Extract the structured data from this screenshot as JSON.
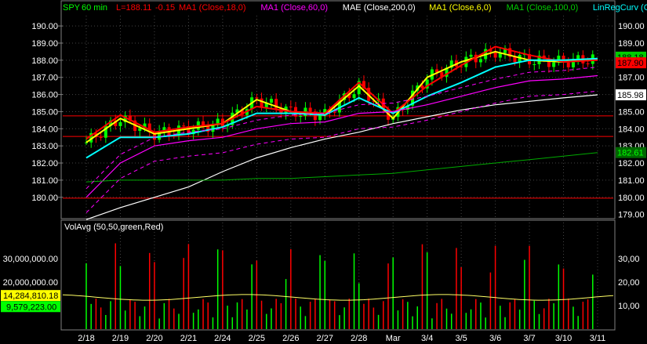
{
  "header": {
    "symbol": "SPY",
    "interval": "60 min",
    "last_label": "L=188.11",
    "change_label": "-0.15",
    "studies": [
      {
        "text": "MA1 (Close,18,0)",
        "color": "#ff0000"
      },
      {
        "text": "MA1 (Close,60,0)",
        "color": "#ff00ff"
      },
      {
        "text": "MAE (Close,200,0)",
        "color": "#ffffff"
      },
      {
        "text": "MA1 (Close,6,0)",
        "color": "#ffff00"
      },
      {
        "text": "MA1 (Close,100,0)",
        "color": "#00cc00"
      },
      {
        "text": "LinRegCurv (C…",
        "color": "#00ffff"
      }
    ]
  },
  "price_axis": {
    "ticks": [
      "190.00",
      "189.00",
      "188.00",
      "187.00",
      "186.00",
      "185.00",
      "184.00",
      "183.00",
      "182.00",
      "181.00",
      "180.00"
    ],
    "right_ticks": [
      "190.00",
      "189.00",
      "187.00",
      "186.00",
      "185.00",
      "184.00",
      "183.00",
      "182.00",
      "181.00",
      "180.00",
      "179.00"
    ],
    "ymin": 178.8,
    "ymax": 190.6,
    "tags": [
      {
        "text": "188.18",
        "value": 188.18,
        "bg": "#00cc00",
        "fg": "#000000"
      },
      {
        "text": "187.90",
        "value": 187.85,
        "bg": "#ff0000",
        "fg": "#000000"
      },
      {
        "text": "185.98",
        "value": 185.98,
        "bg": "#ffffff",
        "fg": "#000000"
      },
      {
        "text": "182.61",
        "value": 182.61,
        "bg": "#006600",
        "fg": "#00ff00"
      }
    ],
    "hlines": [
      184.75,
      183.55,
      179.95
    ]
  },
  "volume": {
    "title": "VolAvg (50,50,green,Red)",
    "ticks": [
      "30,000,000.00",
      "20,000,000.00"
    ],
    "right_ticks": [
      "30,00",
      "20,00",
      "10,00"
    ],
    "avg_tag": "14,284,810.18",
    "last_tag": "9,579,223.00",
    "vmax": 40000000
  },
  "date_axis": {
    "labels": [
      "2/18",
      "2/19",
      "2/20",
      "2/21",
      "2/24",
      "2/25",
      "2/26",
      "2/27",
      "2/28",
      "Mar",
      "3/4",
      "3/5",
      "3/6",
      "3/7",
      "3/10",
      "3/11"
    ]
  },
  "colors": {
    "up": "#00ff00",
    "down": "#ff0000",
    "grid": "#444444",
    "axis_text": "#ffffff"
  },
  "chart_data": {
    "type": "line",
    "title": "SPY - 60 min",
    "x": [
      "2/18",
      "2/19",
      "2/20",
      "2/21",
      "2/24",
      "2/25",
      "2/26",
      "2/27",
      "2/28",
      "Mar",
      "3/4",
      "3/5",
      "3/6",
      "3/7",
      "3/10",
      "3/11"
    ],
    "series": [
      {
        "name": "MA1 (Close,6,0)",
        "values": [
          183.2,
          184.6,
          183.7,
          184.0,
          184.3,
          185.7,
          185.0,
          184.8,
          186.5,
          184.6,
          187.0,
          187.9,
          188.5,
          188.0,
          187.9,
          188.1
        ]
      },
      {
        "name": "MA1 (Close,18,0)",
        "values": [
          183.4,
          184.8,
          183.8,
          184.1,
          184.3,
          185.3,
          185.0,
          184.9,
          186.7,
          184.9,
          186.5,
          187.7,
          188.8,
          188.3,
          187.9,
          188.0
        ]
      },
      {
        "name": "LinRegCurv (C…",
        "values": [
          182.3,
          183.5,
          183.5,
          183.7,
          184.1,
          184.9,
          184.9,
          184.8,
          185.8,
          184.9,
          185.9,
          186.7,
          187.6,
          188.0,
          188.0,
          188.1
        ]
      },
      {
        "name": "MA1 (Close,60,0)",
        "values": [
          180.0,
          182.0,
          183.0,
          183.3,
          183.5,
          184.0,
          184.3,
          184.4,
          184.9,
          185.0,
          185.4,
          185.9,
          186.4,
          186.8,
          186.9,
          187.1
        ]
      },
      {
        "name": "MAE (Close,200,0)",
        "values": [
          178.7,
          179.4,
          180.0,
          180.6,
          181.5,
          182.3,
          182.9,
          183.4,
          183.8,
          184.3,
          184.7,
          185.1,
          185.4,
          185.6,
          185.8,
          185.98
        ]
      },
      {
        "name": "MA1 (Close,100,0)",
        "values": [
          180.9,
          181.0,
          181.0,
          181.0,
          181.0,
          181.1,
          181.1,
          181.2,
          181.3,
          181.4,
          181.6,
          181.8,
          182.0,
          182.2,
          182.4,
          182.61
        ]
      }
    ],
    "ylim": [
      178.8,
      190.6
    ]
  }
}
